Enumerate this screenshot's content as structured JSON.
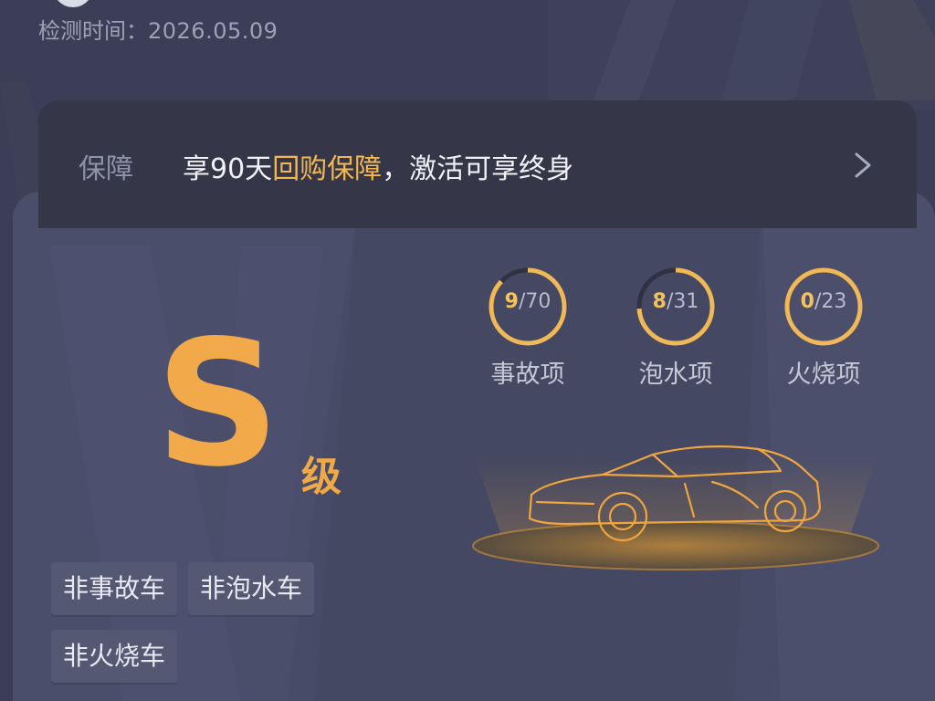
{
  "header": {
    "detect_time_label": "检测时间：",
    "detect_time_value": "2026.05.09"
  },
  "guarantee": {
    "label": "保障",
    "text_before": "享90天",
    "text_highlight": "回购保障",
    "text_after": "，激活可享终身",
    "chevron_icon": "chevron-right-icon"
  },
  "grade": {
    "letter": "S",
    "suffix": "级"
  },
  "stats": [
    {
      "current": "9",
      "total": "/70",
      "label": "事故项",
      "fraction": 0.87
    },
    {
      "current": "8",
      "total": "/31",
      "label": "泡水项",
      "fraction": 0.74
    },
    {
      "current": "0",
      "total": "/23",
      "label": "火烧项",
      "fraction": 1.0
    }
  ],
  "tags": [
    "非事故车",
    "非泡水车",
    "非火烧车"
  ],
  "colors": {
    "accent": "#f1a94a",
    "highlight": "#f5b84f",
    "ring": "#f0b857",
    "ring_track": "#2f3244",
    "card_bg": "#464a66"
  },
  "car_icon": "car-wireframe-icon"
}
